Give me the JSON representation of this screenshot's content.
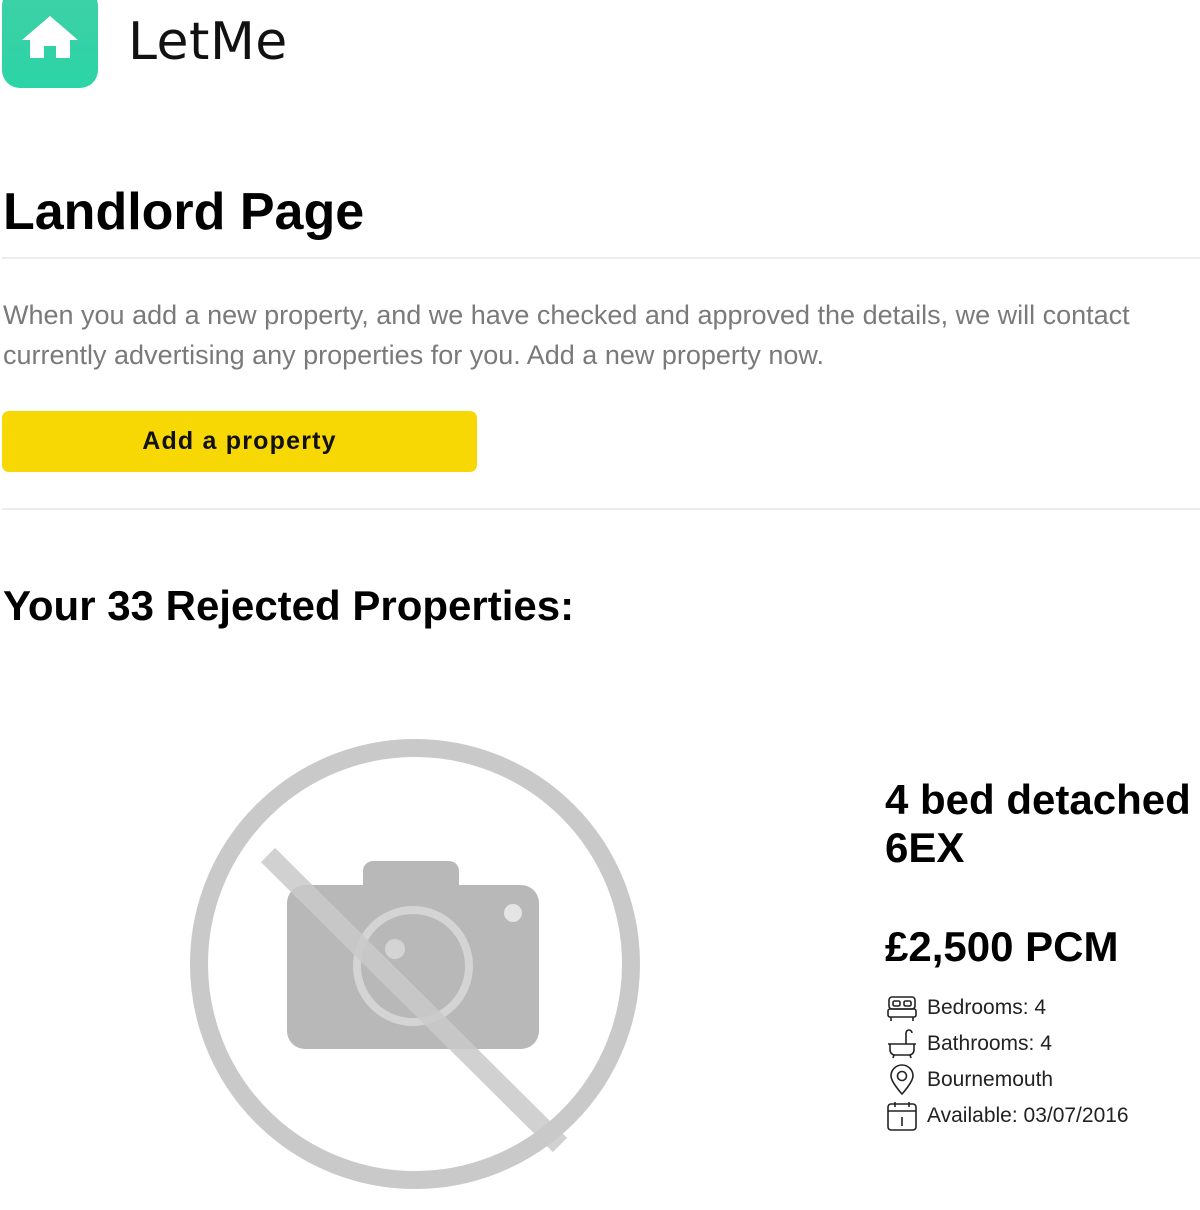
{
  "brand": {
    "name": "LetMe",
    "logo_icon": "house-icon",
    "logo_color": "#2fd3a6"
  },
  "page": {
    "title": "Landlord Page"
  },
  "intro": {
    "line1": "When you add a new property, and we have checked and approved the details, we will contact",
    "line2": "currently advertising any properties for you. Add a new property now."
  },
  "actions": {
    "add_property_label": "Add a property",
    "accent_color": "#f7d804"
  },
  "rejected": {
    "heading": "Your 33 Rejected Properties:"
  },
  "property": {
    "title_line1": "4 bed detached",
    "title_line2": "6EX",
    "price": "£2,500 PCM",
    "image_icon": "no-photo-icon",
    "features": [
      {
        "icon": "bed-icon",
        "text": "Bedrooms: 4"
      },
      {
        "icon": "bath-icon",
        "text": "Bathrooms: 4"
      },
      {
        "icon": "location-pin-icon",
        "text": "Bournemouth"
      },
      {
        "icon": "calendar-icon",
        "text": "Available: 03/07/2016"
      }
    ]
  }
}
